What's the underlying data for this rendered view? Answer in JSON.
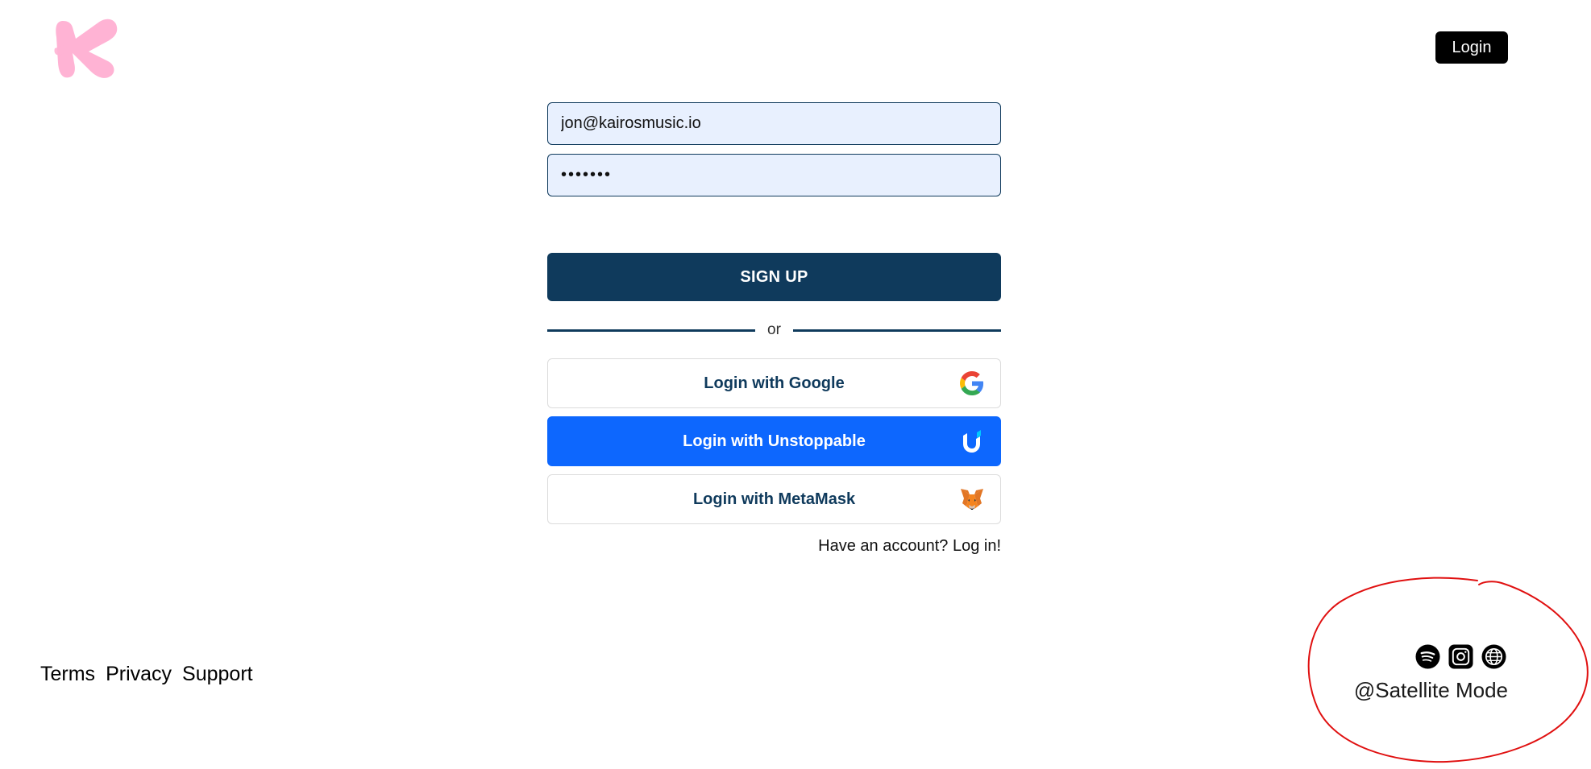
{
  "brand": {
    "logo_icon": "kairos-k-logo",
    "logo_color": "#ffb3d4"
  },
  "header": {
    "login_label": "Login"
  },
  "form": {
    "email_value": "jon@kairosmusic.io",
    "password_value": "•••••••",
    "signup_label": "SIGN UP",
    "divider_text": "or",
    "providers": [
      {
        "label": "Login with Google",
        "icon": "google-icon"
      },
      {
        "label": "Login with Unstoppable",
        "icon": "unstoppable-icon"
      },
      {
        "label": "Login with MetaMask",
        "icon": "metamask-fox-icon"
      }
    ],
    "have_account_text": "Have an account? Log in!"
  },
  "footer": {
    "links": [
      "Terms",
      "Privacy",
      "Support"
    ],
    "social_icons": [
      "spotify-icon",
      "instagram-icon",
      "globe-icon"
    ],
    "handle": "@Satellite Mode"
  },
  "colors": {
    "primary": "#0f3a5c",
    "unstoppable_blue": "#0d67fe",
    "field_bg": "#e8f0fe",
    "annotation_red": "#e01010"
  }
}
